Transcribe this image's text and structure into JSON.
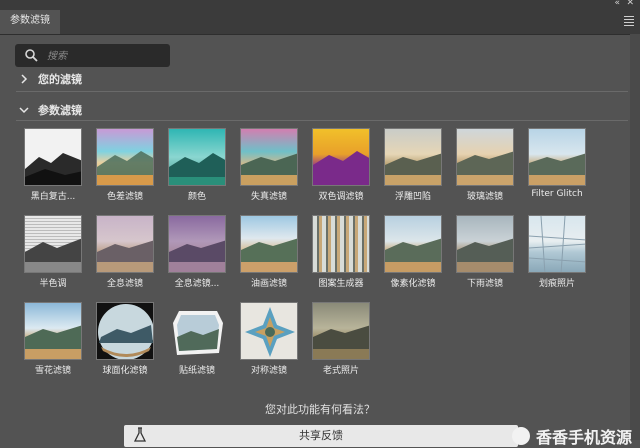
{
  "panel": {
    "tab_label": "参数滤镜"
  },
  "search": {
    "placeholder": "搜索"
  },
  "sections": {
    "yours": "您的滤镜",
    "params": "参数滤镜"
  },
  "filters": [
    "黑白复古...",
    "色差滤镜",
    "颜色",
    "失真滤镜",
    "双色调滤镜",
    "浮雕凹陷",
    "玻璃滤镜",
    "Filter Glitch",
    "半色调",
    "全息滤镜",
    "全息滤镜...",
    "油画滤镜",
    "图案生成器",
    "像素化滤镜",
    "下雨滤镜",
    "划痕照片",
    "雪花滤镜",
    "球面化滤镜",
    "贴纸滤镜",
    "对称滤镜",
    "老式照片"
  ],
  "feedback": {
    "question": "您对此功能有何看法？",
    "share_label": "共享反馈"
  },
  "watermark": "香香手机资源"
}
